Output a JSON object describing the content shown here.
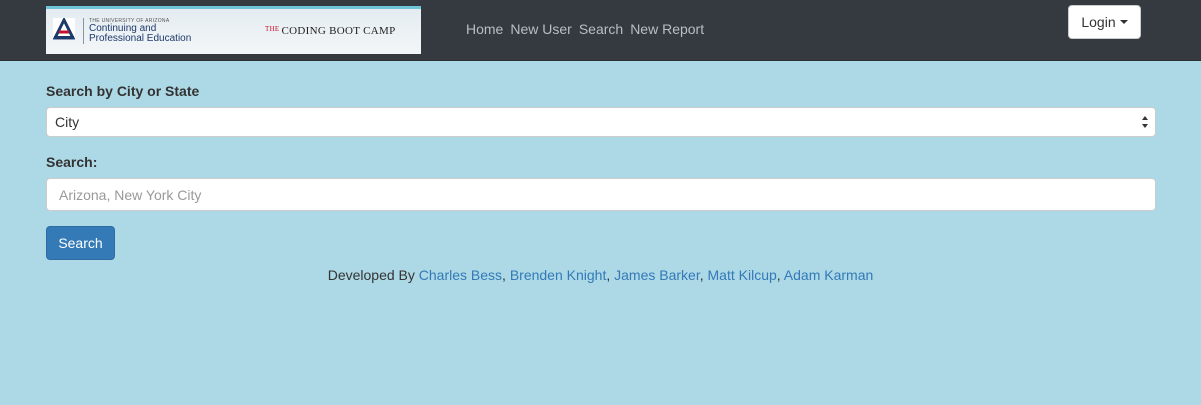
{
  "brand": {
    "university_small": "THE UNIVERSITY OF ARIZONA",
    "department_line1": "Continuing and",
    "department_line2": "Professional Education",
    "bootcamp_prefix": "THE",
    "bootcamp_name": "CODING BOOT CAMP"
  },
  "nav": {
    "items": [
      {
        "label": "Home"
      },
      {
        "label": "New User"
      },
      {
        "label": "Search"
      },
      {
        "label": "New Report"
      }
    ],
    "login_label": "Login"
  },
  "form": {
    "select_label": "Search by City or State",
    "select_value": "City",
    "search_label": "Search:",
    "search_placeholder": "Arizona, New York City",
    "search_value": "",
    "submit_label": "Search"
  },
  "footer": {
    "prefix": "Developed By",
    "developers": [
      {
        "name": "Charles Bess"
      },
      {
        "name": "Brenden Knight"
      },
      {
        "name": "James Barker"
      },
      {
        "name": "Matt Kilcup"
      },
      {
        "name": "Adam Karman"
      }
    ],
    "separator": ","
  },
  "colors": {
    "background": "#add8e6",
    "navbar": "#343a40",
    "primary": "#337ab7",
    "brand_red": "#c8102e"
  }
}
